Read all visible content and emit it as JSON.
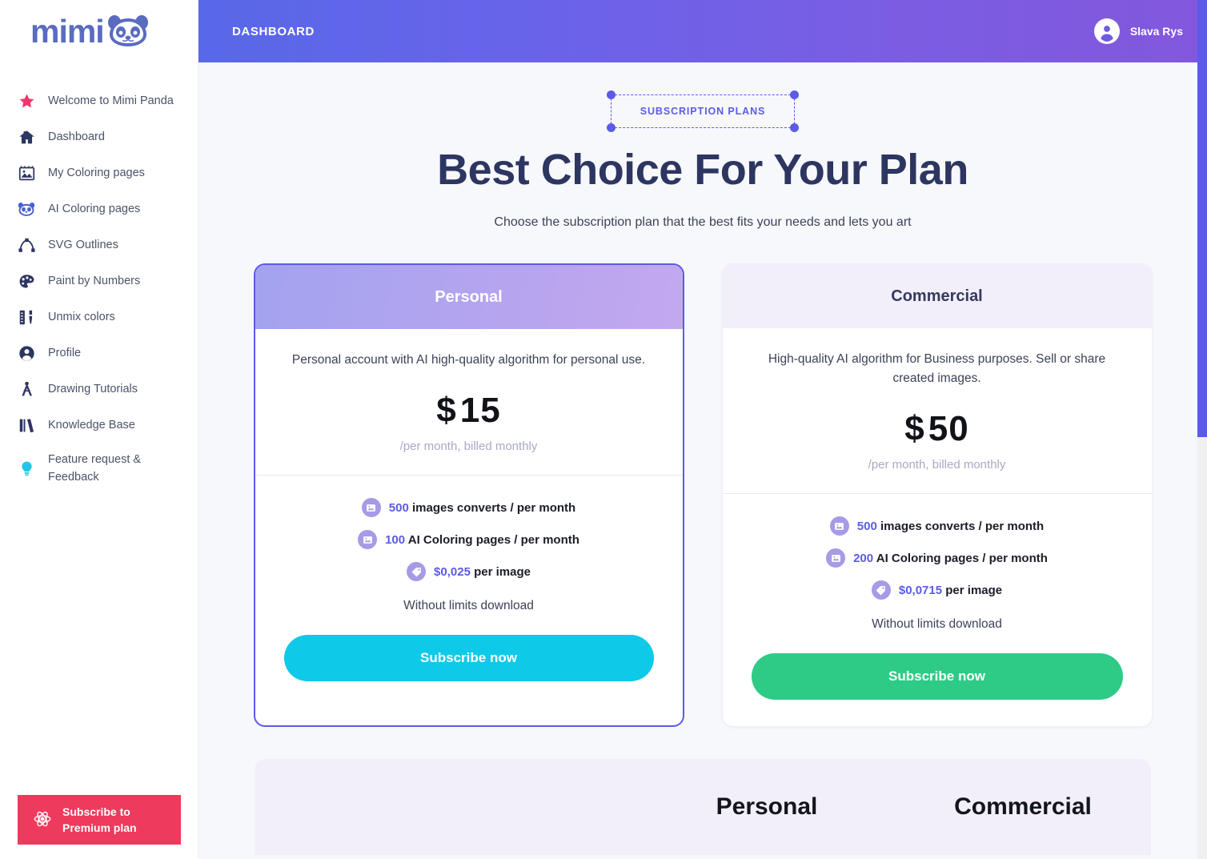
{
  "brand": {
    "name": "mimi",
    "logo_icon": "panda-logo-icon",
    "color": "#5a6cc0"
  },
  "sidebar": {
    "items": [
      {
        "label": "Welcome to Mimi Panda",
        "icon": "star-icon"
      },
      {
        "label": "Dashboard",
        "icon": "home-icon"
      },
      {
        "label": "My Coloring pages",
        "icon": "image-frame-icon"
      },
      {
        "label": "AI Coloring pages",
        "icon": "panda-icon"
      },
      {
        "label": "SVG Outlines",
        "icon": "bezier-curve-icon"
      },
      {
        "label": "Paint by Numbers",
        "icon": "palette-icon"
      },
      {
        "label": "Unmix colors",
        "icon": "color-mixer-icon"
      },
      {
        "label": "Profile",
        "icon": "user-circle-icon"
      },
      {
        "label": "Drawing Tutorials",
        "icon": "compass-icon"
      },
      {
        "label": "Knowledge Base",
        "icon": "books-icon"
      },
      {
        "label": "Feature request & Feedback",
        "icon": "lightbulb-icon"
      }
    ],
    "premium_button": {
      "label": "Subscribe to Premium plan",
      "icon": "atom-icon",
      "color": "#ee3a5c"
    }
  },
  "topbar": {
    "title": "DASHBOARD",
    "user": {
      "name": "Slava Rys",
      "avatar_icon": "user-avatar-icon"
    },
    "gradient_from": "#5868e8",
    "gradient_to": "#8257dd"
  },
  "hero": {
    "badge": "SUBSCRIPTION PLANS",
    "title": "Best Choice For Your Plan",
    "subtitle": "Choose the subscription plan that the best fits your needs and lets you art"
  },
  "plans": [
    {
      "name": "Personal",
      "description": "Personal account with AI high-quality algorithm for personal use.",
      "currency": "$",
      "price": "15",
      "price_note": "/per month, billed monthly",
      "features": [
        {
          "icon": "image-icon",
          "highlight": "500",
          "text": "images converts / per month"
        },
        {
          "icon": "image-icon",
          "highlight": "100",
          "text": "AI Coloring pages / per month"
        },
        {
          "icon": "tag-icon",
          "highlight": "$0,025",
          "text": "per image"
        }
      ],
      "extra": "Without limits download",
      "cta": "Subscribe now",
      "cta_color": "#0fc9e9",
      "selected": true
    },
    {
      "name": "Commercial",
      "description": "High-quality AI algorithm for Business purposes. Sell or share created images.",
      "currency": "$",
      "price": "50",
      "price_note": "/per month, billed monthly",
      "features": [
        {
          "icon": "image-icon",
          "highlight": "500",
          "text": "images converts / per month"
        },
        {
          "icon": "image-icon",
          "highlight": "200",
          "text": "AI Coloring pages / per month"
        },
        {
          "icon": "tag-icon",
          "highlight": "$0,0715",
          "text": "per image"
        }
      ],
      "extra": "Without limits download",
      "cta": "Subscribe now",
      "cta_color": "#2ecb87",
      "selected": false
    }
  ],
  "comparison": {
    "col_personal": "Personal",
    "col_commercial": "Commercial"
  }
}
